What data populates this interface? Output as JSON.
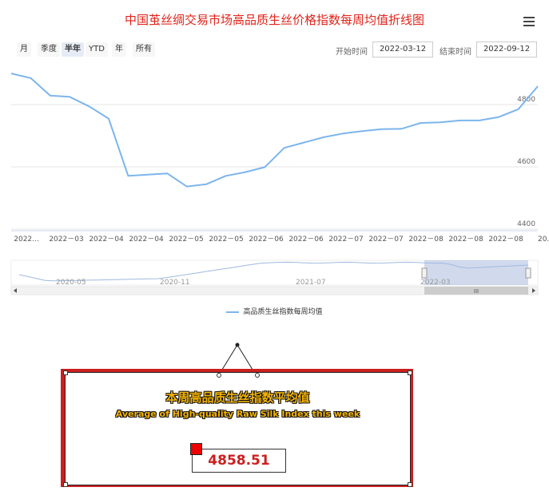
{
  "title": "中国茧丝绸交易市场高品质生丝价格指数每周均值折线图",
  "range_buttons": [
    "月",
    "季度",
    "半年",
    "YTD",
    "年",
    "所有"
  ],
  "active_range": "半年",
  "start_label": "开始时间",
  "start_value": "2022-03-12",
  "end_label": "结束时间",
  "end_value": "2022-09-12",
  "colors": {
    "line": "#7cb5ec",
    "title": "#e2231a",
    "panel": "#cc1f1f",
    "accent": "#f5b400"
  },
  "chart_data": {
    "type": "line",
    "title": "中国茧丝绸交易市场高品质生丝价格指数每周均值折线图",
    "x": [
      "2022-03-11",
      "2022-03-18",
      "2022-03-25",
      "2022-04-01",
      "2022-04-08",
      "2022-04-15",
      "2022-04-22",
      "2022-04-29",
      "2022-05-06",
      "2022-05-13",
      "2022-05-20",
      "2022-05-27",
      "2022-06-03",
      "2022-06-10",
      "2022-06-17",
      "2022-06-24",
      "2022-07-01",
      "2022-07-08",
      "2022-07-15",
      "2022-07-22",
      "2022-07-29",
      "2022-08-05",
      "2022-08-12",
      "2022-08-19",
      "2022-08-26",
      "2022-09-02",
      "2022-09-09",
      "2022-09-16"
    ],
    "x_tick_labels": [
      "2022...",
      "2022－03",
      "2022－04",
      "2022－04",
      "2022－05",
      "2022－05",
      "2022－06",
      "2022－06",
      "2022－07",
      "2022－07",
      "2022－08",
      "2022－08",
      "2022－08",
      "20..."
    ],
    "series": [
      {
        "name": "高品质生丝指数每周均值",
        "values": [
          4900,
          4885,
          4829,
          4825,
          4794,
          4755,
          4571,
          4575,
          4579,
          4537,
          4544,
          4571,
          4583,
          4599,
          4661,
          4678,
          4695,
          4707,
          4715,
          4721,
          4722,
          4741,
          4743,
          4749,
          4749,
          4760,
          4785,
          4859
        ]
      }
    ],
    "y_ticks": [
      "4400",
      "4600",
      "4800"
    ],
    "ylim": [
      4400,
      4900
    ],
    "grid": true,
    "legend": "bottom-center"
  },
  "navigator": {
    "labels": [
      "2020-05",
      "2020-11",
      "2021-07",
      "2022-03"
    ],
    "scroll_glyph": "III"
  },
  "legend_label": "高品质生丝指数每周均值",
  "panel": {
    "title_cn": "本周高品质生丝指数平均值",
    "title_en": "Average of High-quality Raw Silk Index this week",
    "value": "4858.51"
  }
}
